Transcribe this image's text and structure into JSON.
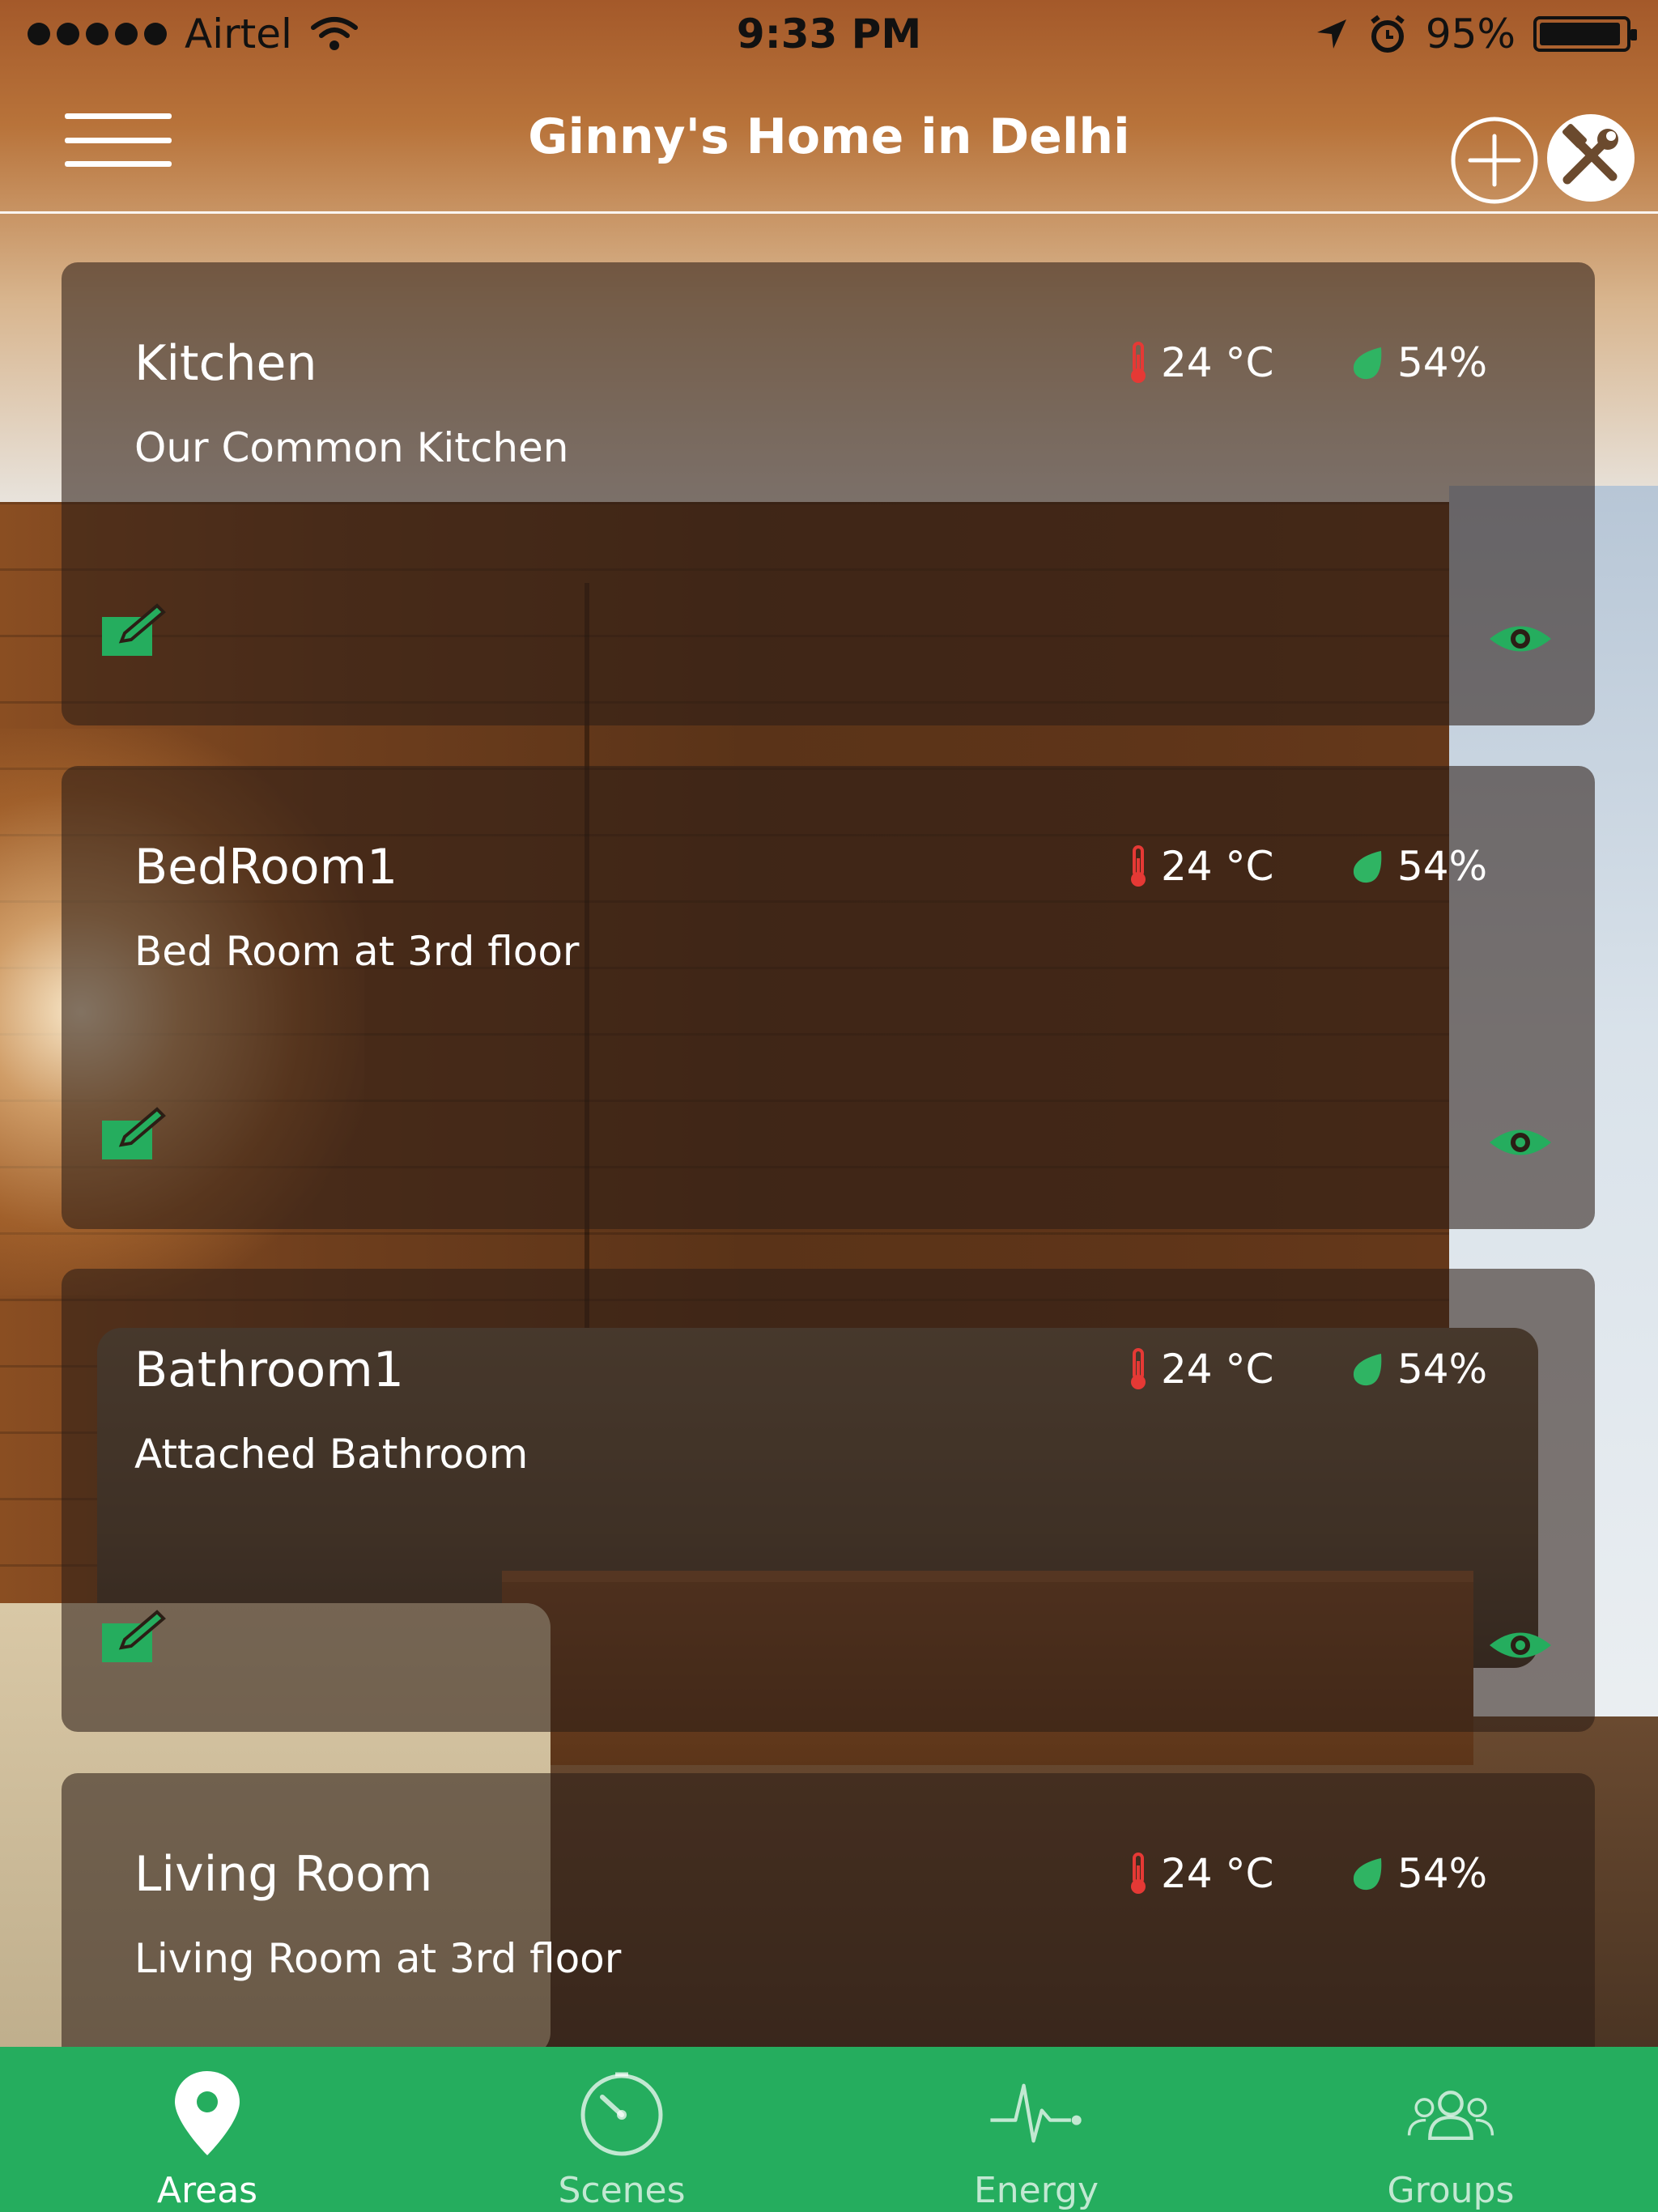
{
  "status_bar": {
    "carrier": "Airtel",
    "time": "9:33 PM",
    "battery": "95%",
    "battery_level": 0.95
  },
  "header": {
    "title": "Ginny's Home in Delhi",
    "menu_icon": "hamburger-menu-icon",
    "add_icon": "plus-circle-icon",
    "settings_icon": "tools-wrench-hammer-icon"
  },
  "rooms": [
    {
      "name": "Kitchen",
      "description": "Our Common Kitchen",
      "temperature": "24 °C",
      "humidity": "54%"
    },
    {
      "name": "BedRoom1",
      "description": "Bed Room at 3rd floor",
      "temperature": "24 °C",
      "humidity": "54%"
    },
    {
      "name": "Bathroom1",
      "description": "Attached Bathroom",
      "temperature": "24 °C",
      "humidity": "54%"
    },
    {
      "name": "Living Room",
      "description": "Living Room at 3rd floor",
      "temperature": "24 °C",
      "humidity": "54%"
    }
  ],
  "tabs": [
    {
      "label": "Areas",
      "icon": "map-pin-icon",
      "active": true
    },
    {
      "label": "Scenes",
      "icon": "timer-dial-icon",
      "active": false
    },
    {
      "label": "Energy",
      "icon": "heartbeat-pulse-icon",
      "active": false
    },
    {
      "label": "Groups",
      "icon": "people-group-icon",
      "active": false
    }
  ],
  "colors": {
    "accent_green": "#25ad5e",
    "temperature_red": "#e53935",
    "humidity_green": "#2fb463"
  }
}
